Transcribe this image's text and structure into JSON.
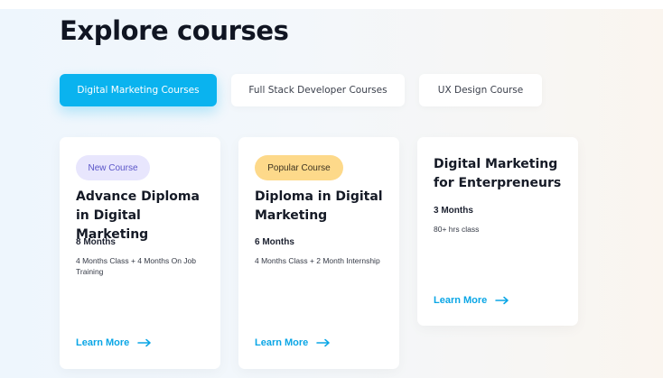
{
  "page": {
    "title": "Explore courses"
  },
  "tabs": [
    {
      "label": "Digital Marketing Courses",
      "active": true
    },
    {
      "label": "Full Stack Developer Courses",
      "active": false
    },
    {
      "label": "UX Design Course",
      "active": false
    }
  ],
  "courses": [
    {
      "badge": "New Course",
      "title": "Advance Diploma in Digital Marketing",
      "duration": "8 Months",
      "description": "4 Months Class + 4 Months On Job Training",
      "link": "Learn More"
    },
    {
      "badge": "Popular Course",
      "title": "Diploma in Digital Marketing",
      "duration": "6 Months",
      "description": "4 Months Class + 2 Month Internship",
      "link": "Learn More"
    },
    {
      "badge": "",
      "title": "Digital Marketing for Enterpreneurs",
      "duration": "3 Months",
      "description": "80+ hrs class",
      "link": "Learn More"
    }
  ],
  "colors": {
    "accent": "#0ab3ef",
    "link": "#0aa6e6",
    "new_badge_bg": "#e8e6fd",
    "popular_badge_bg": "#fdd98a"
  },
  "icons": {
    "learn_more": "arrow-right-icon"
  }
}
